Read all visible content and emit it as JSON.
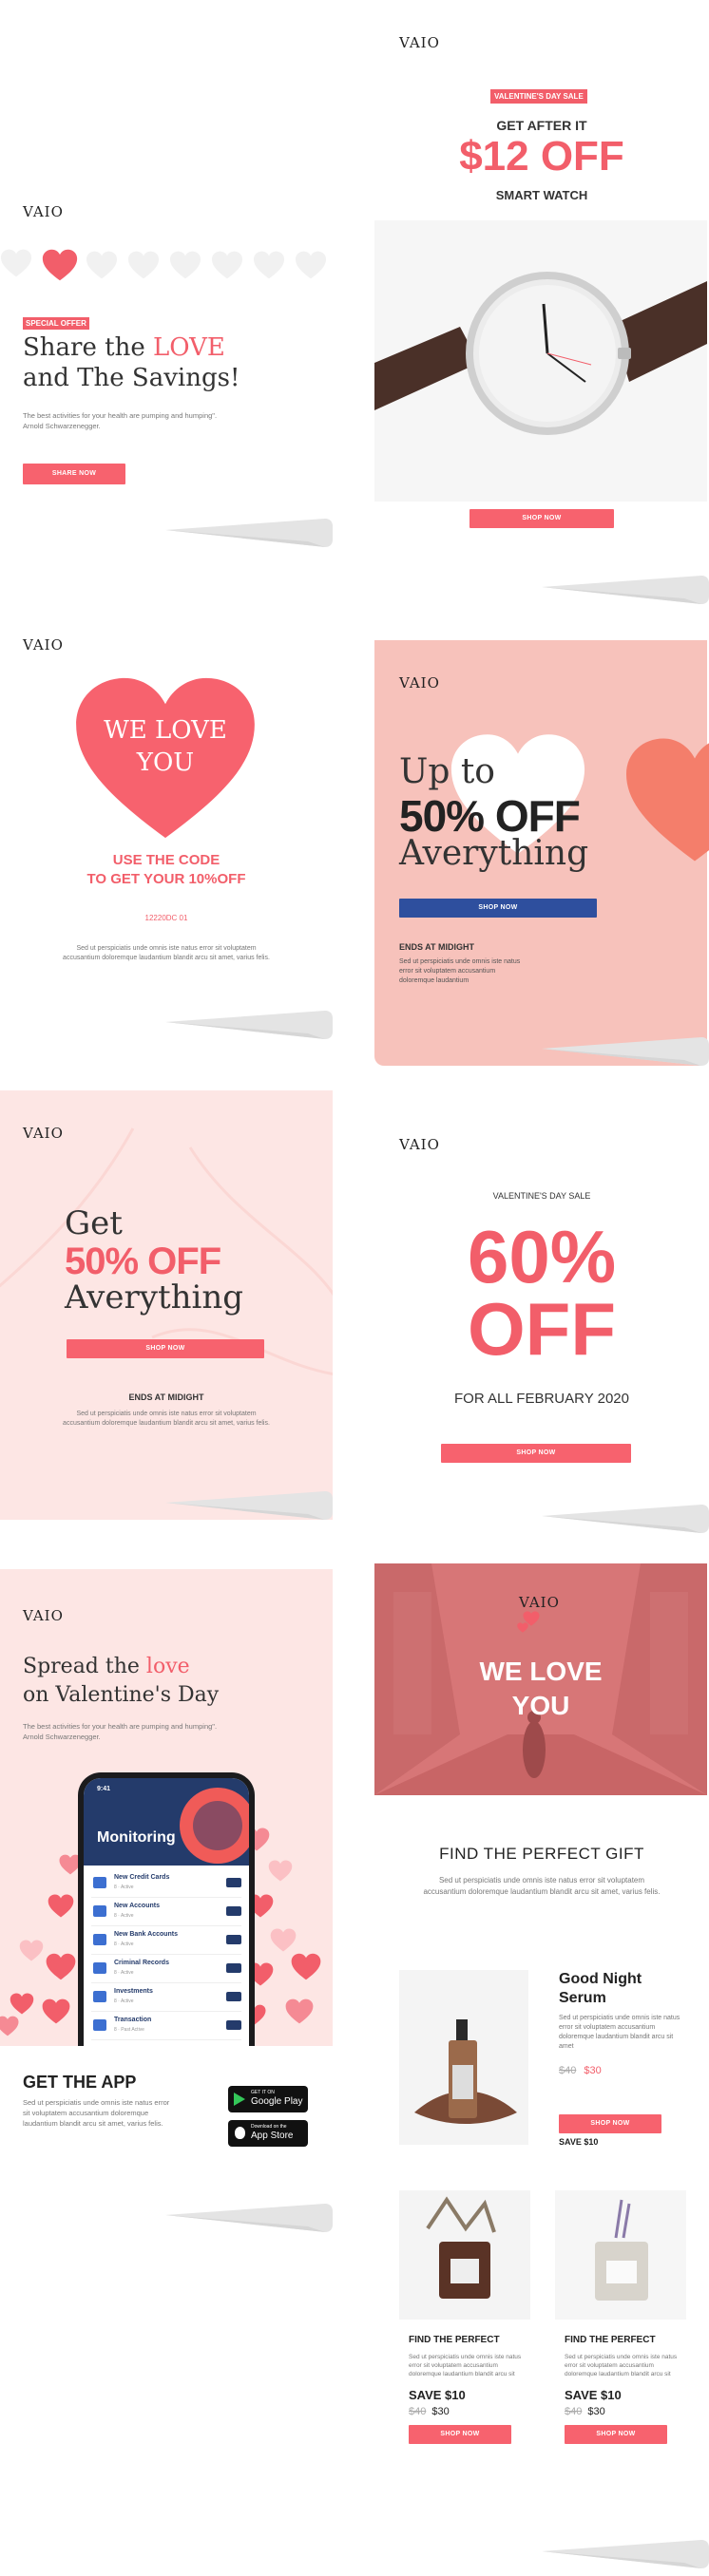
{
  "brand": {
    "logo": "VAIO"
  },
  "colors": {
    "accent": "#f25e6a",
    "blush": "#fde6e4",
    "salmon": "#f7c2bb",
    "blue": "#2e4f9e"
  },
  "card1": {
    "badge": "SPECIAL OFFER",
    "headline_1": "Share the ",
    "headline_love": "LOVE",
    "headline_2": "and The Savings!",
    "body": "The best activities for your health are pumping and humping\". Arnold Schwarzenegger.",
    "cta": "SHARE NOW",
    "rating": 1
  },
  "card2": {
    "badge": "VALENTINE'S DAY SALE",
    "kicker": "GET AFTER IT",
    "price": "$12 OFF",
    "product": "SMART WATCH",
    "cta": "SHOP NOW"
  },
  "card3": {
    "heart_text_1": "WE LOVE",
    "heart_text_2": "YOU",
    "code_line_1": "USE THE CODE",
    "code_line_2": "TO GET YOUR 10%OFF",
    "code": "12220DC 01",
    "body": "Sed ut perspiciatis unde omnis iste natus error sit voluptatem accusantium doloremque laudantium blandit arcu sit amet, varius felis."
  },
  "card4": {
    "line1": "Up to",
    "line2": "50% OFF",
    "line3": "Averything",
    "cta": "SHOP NOW",
    "ends": "ENDS AT MIDIGHT",
    "body": "Sed ut perspiciatis unde omnis iste natus error sit voluptatem accusantium doloremque laudantium"
  },
  "card5": {
    "line1": "Get",
    "line2": "50% OFF",
    "line3": "Averything",
    "cta": "SHOP NOW",
    "ends": "ENDS AT MIDIGHT",
    "body": "Sed ut perspiciatis unde omnis iste natus error sit voluptatem accusantium doloremque laudantium blandit arcu sit amet, varius felis."
  },
  "card6": {
    "kicker": "VALENTINE'S DAY SALE",
    "big1": "60%",
    "big2": "OFF",
    "sub": "FOR ALL FEBRUARY 2020",
    "cta": "SHOP NOW"
  },
  "card7": {
    "headline_1": "Spread the ",
    "headline_love": "love",
    "headline_2": "on Valentine's Day",
    "body": "The best activities for your health are pumping and humping\". Arnold Schwarzenegger.",
    "phone_time": "9:41",
    "phone_title": "Monitoring",
    "phone_items": [
      {
        "title": "New Credit Cards",
        "sub": "8 · Active"
      },
      {
        "title": "New Accounts",
        "sub": "8 · Active"
      },
      {
        "title": "New Bank Accounts",
        "sub": "8 · Active"
      },
      {
        "title": "Criminal Records",
        "sub": "8 · Active"
      },
      {
        "title": "Investments",
        "sub": "8 · Active"
      },
      {
        "title": "Transaction",
        "sub": "8 · Past Active"
      }
    ],
    "app_title": "GET THE APP",
    "app_body": "Sed ut perspiciatis unde omnis iste natus error sit voluptatem accusantium doloremque laudantium blandit arcu sit amet, varius felis.",
    "google_small": "GET IT ON",
    "google_big": "Google Play",
    "apple_small": "Download on the",
    "apple_big": "App Store"
  },
  "card8": {
    "hero_1": "WE LOVE",
    "hero_2": "YOU",
    "section_title": "FIND THE PERFECT GIFT",
    "section_body": "Sed ut perspiciatis unde omnis iste natus error sit voluptatem accusantium doloremque laudantium blandit arcu sit amet, varius felis.",
    "product_title": "Good Night Serum",
    "product_body": "Sed ut perspiciatis unde omnis iste natus error sit voluptatem accusantium doloremque laudantium blandit arcu sit amet",
    "old_price": "$40",
    "new_price": "$30",
    "cta": "SHOP NOW",
    "save": "SAVE $10",
    "items": [
      {
        "title": "FIND THE PERFECT",
        "body": "Sed ut perspiciatis unde omnis iste natus error sit voluptatem accusantium doloremque laudantium blandit arcu sit",
        "save": "SAVE $10",
        "old": "$40",
        "new": "$30",
        "cta": "SHOP NOW"
      },
      {
        "title": "FIND THE PERFECT",
        "body": "Sed ut perspiciatis unde omnis iste natus error sit voluptatem accusantium doloremque laudantium blandit arcu sit",
        "save": "SAVE $10",
        "old": "$40",
        "new": "$30",
        "cta": "SHOP NOW"
      }
    ]
  }
}
